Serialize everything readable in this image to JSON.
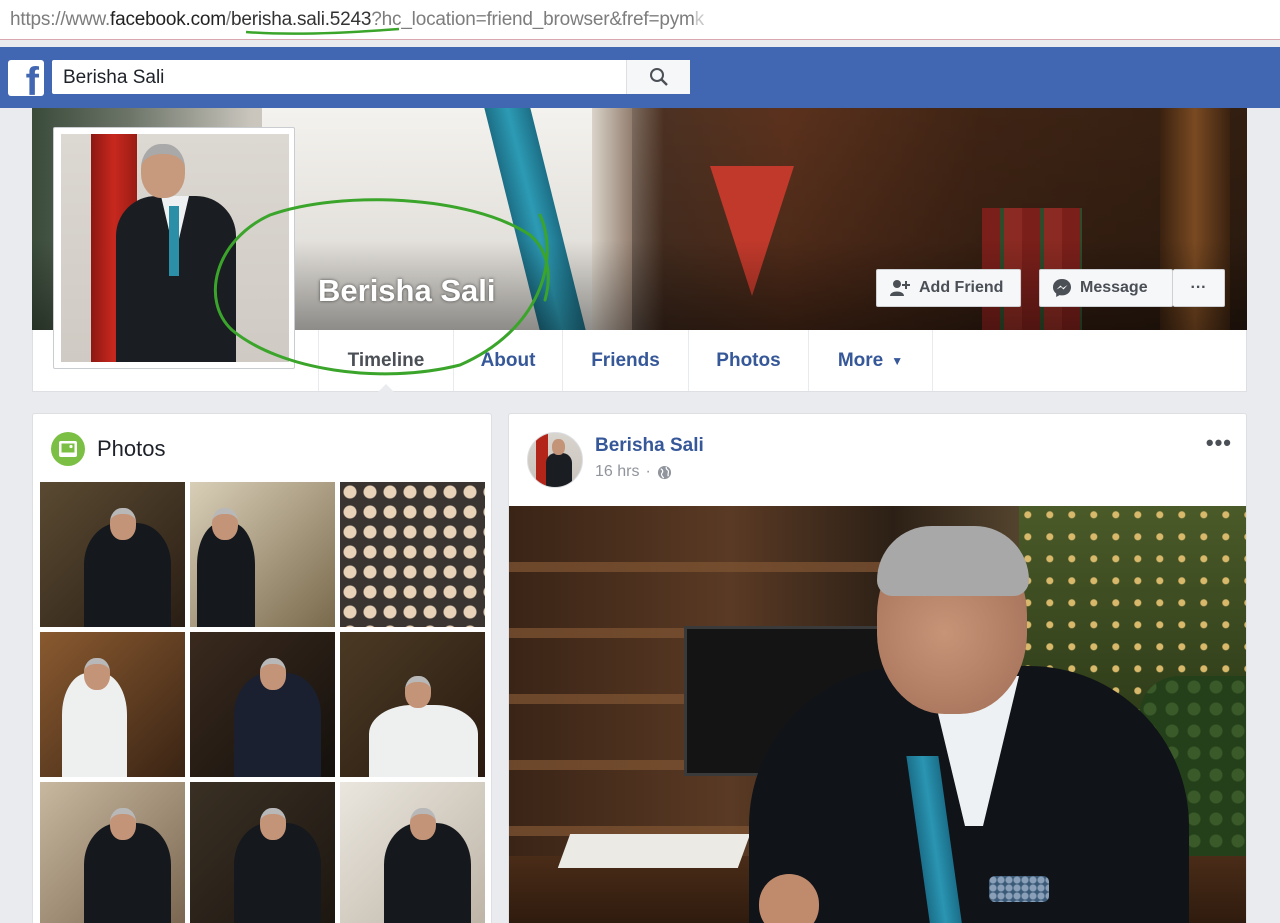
{
  "browser": {
    "url_scheme": "https://www.",
    "url_domain": "facebook.com",
    "url_slash": "/",
    "url_path": "berisha.sali.5243",
    "url_query": "?hc_location=friend_browser&fref=pym",
    "url_fade": "k"
  },
  "header": {
    "logo_letter": "f",
    "search_value": "Berisha Sali",
    "search_icon": "search-icon"
  },
  "profile": {
    "name": "Berisha Sali",
    "add_friend_label": "Add Friend",
    "message_label": "Message",
    "more_options": "···"
  },
  "tabs": [
    {
      "label": "Timeline",
      "active": true
    },
    {
      "label": "About"
    },
    {
      "label": "Friends"
    },
    {
      "label": "Photos"
    },
    {
      "label": "More"
    }
  ],
  "photos_section": {
    "title": "Photos",
    "count": 9
  },
  "post": {
    "author": "Berisha Sali",
    "time": "16 hrs",
    "separator": "·",
    "audience_icon": "globe-icon",
    "menu": "•••"
  },
  "colors": {
    "fb_blue": "#4267b2",
    "link_blue": "#365899",
    "annotation_green": "#3aa52a"
  }
}
